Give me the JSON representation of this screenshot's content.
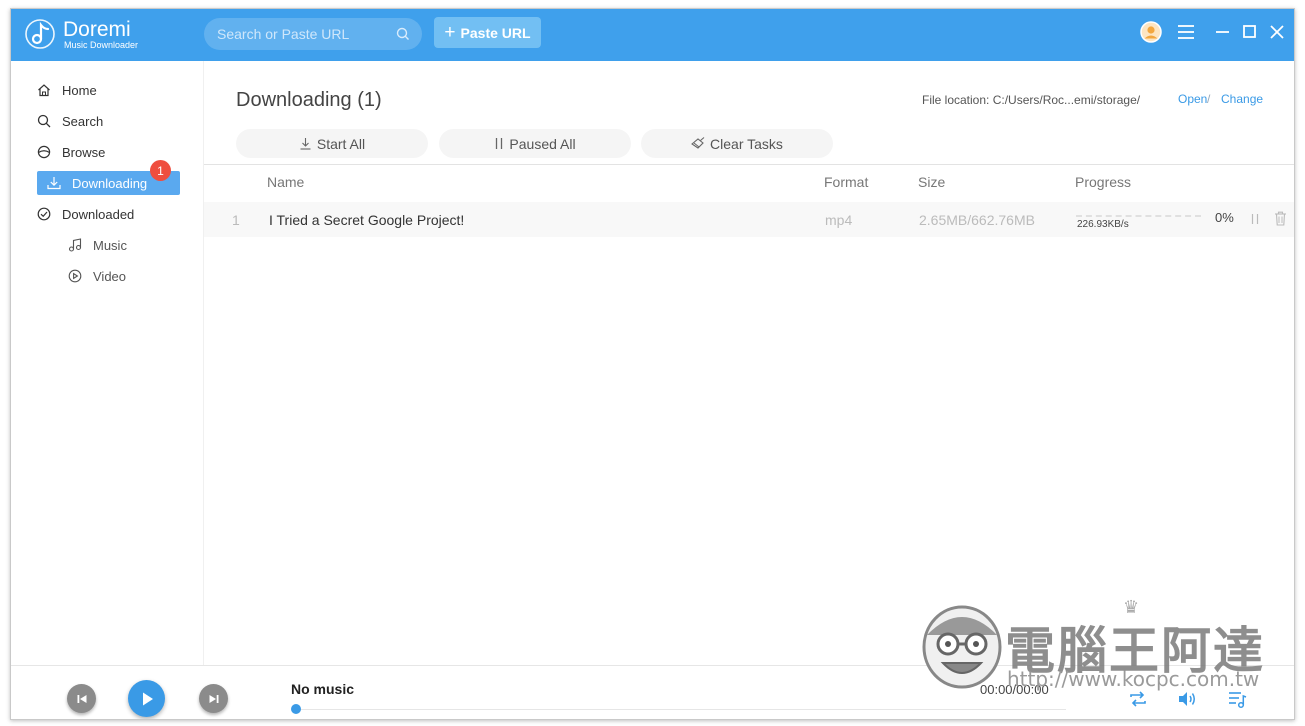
{
  "app": {
    "name": "Doremi",
    "subtitle": "Music Downloader"
  },
  "colors": {
    "titlebar": "#3fa0ec",
    "accent": "#3a9ae6",
    "active_nav": "#5aa9ef",
    "badge": "#ef4e3f"
  },
  "header": {
    "search_placeholder": "Search or Paste URL",
    "paste_label": "Paste URL",
    "icons": [
      "avatar-icon",
      "menu-icon",
      "minimize-icon",
      "maximize-icon",
      "close-icon"
    ]
  },
  "sidebar": {
    "items": [
      {
        "label": "Home",
        "icon": "home-icon"
      },
      {
        "label": "Search",
        "icon": "search-icon"
      },
      {
        "label": "Browse",
        "icon": "browse-icon"
      },
      {
        "label": "Downloading",
        "icon": "download-icon",
        "active": true,
        "badge": "1"
      },
      {
        "label": "Downloaded",
        "icon": "check-circle-icon"
      },
      {
        "label": "Music",
        "icon": "music-note-icon"
      },
      {
        "label": "Video",
        "icon": "play-circle-icon"
      }
    ]
  },
  "main": {
    "title": "Downloading (1)",
    "file_location": "File location: C:/Users/Roc...emi/storage/",
    "open_label": "Open",
    "separator": "/",
    "change_label": "Change",
    "actions": {
      "start_all": "Start All",
      "paused_all": "Paused All",
      "clear_tasks": "Clear Tasks"
    },
    "columns": {
      "name": "Name",
      "format": "Format",
      "size": "Size",
      "progress": "Progress"
    },
    "rows": [
      {
        "index": "1",
        "name": "I Tried a Secret Google Project!",
        "format": "mp4",
        "size": "2.65MB/662.76MB",
        "speed": "226.93KB/s",
        "percent": "0%",
        "progress_fraction": 0
      }
    ]
  },
  "player": {
    "now_playing": "No music",
    "time": "00:00/00:00"
  },
  "watermark": {
    "title": "電腦王阿達",
    "url": "http://www.kocpc.com.tw"
  }
}
